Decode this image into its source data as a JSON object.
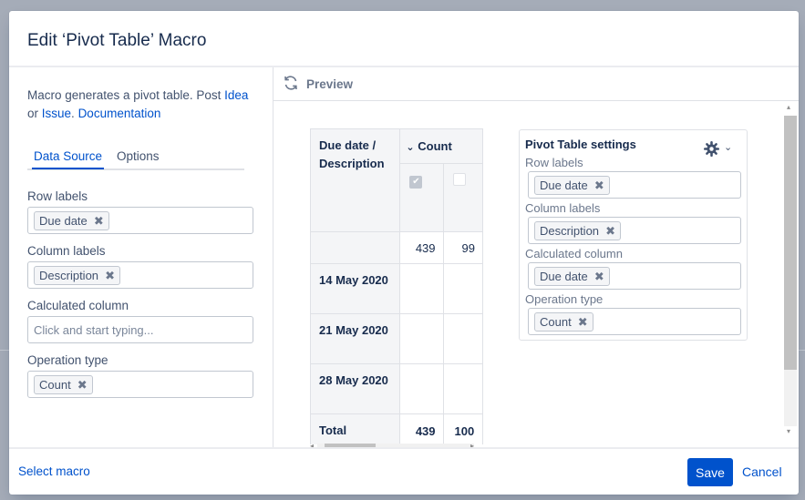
{
  "dialog": {
    "title": "Edit ‘Pivot Table’ Macro"
  },
  "left": {
    "description_prefix": "Macro generates a pivot table. Post ",
    "idea_link": "Idea",
    "or_text": "or ",
    "issue_link": "Issue",
    "period": ". ",
    "documentation_link": "Documentation",
    "tabs": [
      {
        "label": "Data Source",
        "active": true
      },
      {
        "label": "Options",
        "active": false
      }
    ],
    "fields": [
      {
        "label": "Row labels",
        "tag": "Due date"
      },
      {
        "label": "Column labels",
        "tag": "Description"
      },
      {
        "label": "Calculated column",
        "placeholder": "Click and start typing..."
      },
      {
        "label": "Operation type",
        "tag": "Count"
      }
    ]
  },
  "preview": {
    "label": "Preview",
    "table": {
      "corner_header": "Due date / Description",
      "count_header": "Count",
      "count_chevron": "⌄",
      "totals_row": [
        "439",
        "99"
      ],
      "rows": [
        {
          "label": "14 May 2020"
        },
        {
          "label": "21 May 2020"
        },
        {
          "label": "28 May 2020"
        }
      ],
      "total_row": {
        "label": "Total",
        "values": [
          "439",
          "100"
        ]
      }
    },
    "settings": {
      "title": "Pivot Table settings",
      "caret": "⌄",
      "fields": [
        {
          "label": "Row labels",
          "tag": "Due date"
        },
        {
          "label": "Column labels",
          "tag": "Description"
        },
        {
          "label": "Calculated column",
          "tag": "Due date"
        },
        {
          "label": "Operation type",
          "tag": "Count"
        }
      ]
    }
  },
  "footer": {
    "select_macro": "Select macro",
    "save": "Save",
    "cancel": "Cancel"
  },
  "icons": {
    "remove": "✖"
  }
}
